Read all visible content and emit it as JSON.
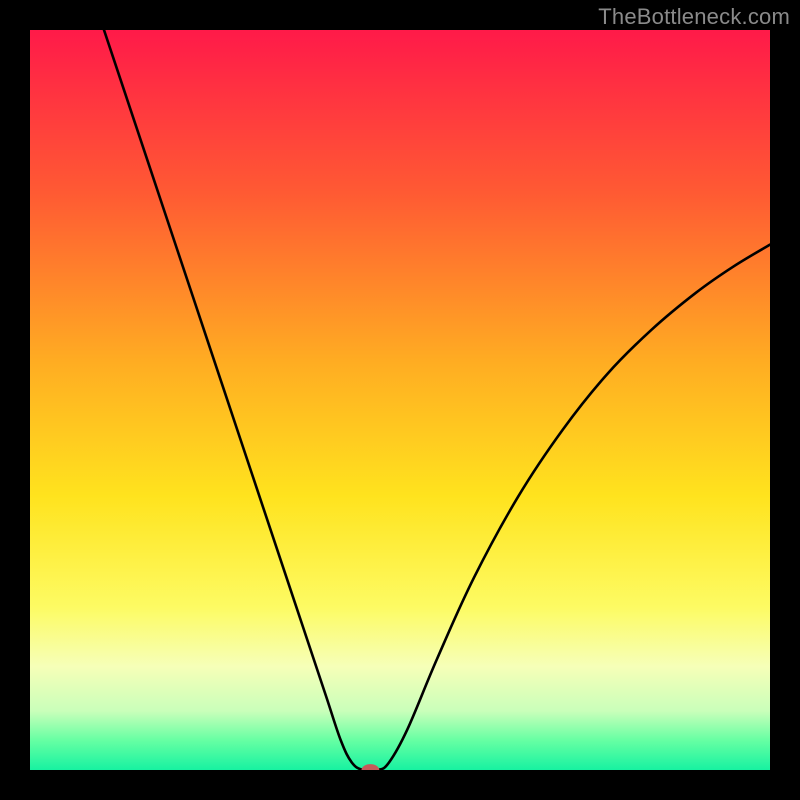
{
  "watermark": "TheBottleneck.com",
  "chart_data": {
    "type": "line",
    "title": "",
    "xlabel": "",
    "ylabel": "",
    "xlim": [
      0,
      100
    ],
    "ylim": [
      0,
      100
    ],
    "grid": false,
    "legend": false,
    "gradient_stops": [
      {
        "offset": 0,
        "color": "#ff1a49"
      },
      {
        "offset": 22,
        "color": "#ff5a33"
      },
      {
        "offset": 45,
        "color": "#ffad22"
      },
      {
        "offset": 63,
        "color": "#ffe31e"
      },
      {
        "offset": 78,
        "color": "#fdfb63"
      },
      {
        "offset": 86,
        "color": "#f6ffb8"
      },
      {
        "offset": 92,
        "color": "#caffba"
      },
      {
        "offset": 96,
        "color": "#66ffa3"
      },
      {
        "offset": 100,
        "color": "#17f2a1"
      }
    ],
    "series": [
      {
        "name": "bottleneck-curve",
        "color": "#000000",
        "points": [
          {
            "x": 10.0,
            "y": 100.0
          },
          {
            "x": 14.0,
            "y": 88.0
          },
          {
            "x": 18.0,
            "y": 76.0
          },
          {
            "x": 22.0,
            "y": 64.0
          },
          {
            "x": 26.0,
            "y": 52.0
          },
          {
            "x": 30.0,
            "y": 40.0
          },
          {
            "x": 34.0,
            "y": 28.0
          },
          {
            "x": 37.0,
            "y": 19.0
          },
          {
            "x": 40.0,
            "y": 10.0
          },
          {
            "x": 42.0,
            "y": 4.0
          },
          {
            "x": 43.5,
            "y": 1.0
          },
          {
            "x": 45.0,
            "y": 0.0
          },
          {
            "x": 47.0,
            "y": 0.0
          },
          {
            "x": 48.5,
            "y": 1.0
          },
          {
            "x": 51.0,
            "y": 5.5
          },
          {
            "x": 55.0,
            "y": 15.0
          },
          {
            "x": 60.0,
            "y": 26.0
          },
          {
            "x": 66.0,
            "y": 37.0
          },
          {
            "x": 72.0,
            "y": 46.0
          },
          {
            "x": 78.0,
            "y": 53.5
          },
          {
            "x": 84.0,
            "y": 59.5
          },
          {
            "x": 90.0,
            "y": 64.5
          },
          {
            "x": 95.0,
            "y": 68.0
          },
          {
            "x": 100.0,
            "y": 71.0
          }
        ]
      }
    ],
    "marker": {
      "name": "bottleneck-point",
      "x": 46.0,
      "y": 0.0,
      "rx": 1.2,
      "ry": 0.8,
      "color": "#c55a5a"
    }
  }
}
